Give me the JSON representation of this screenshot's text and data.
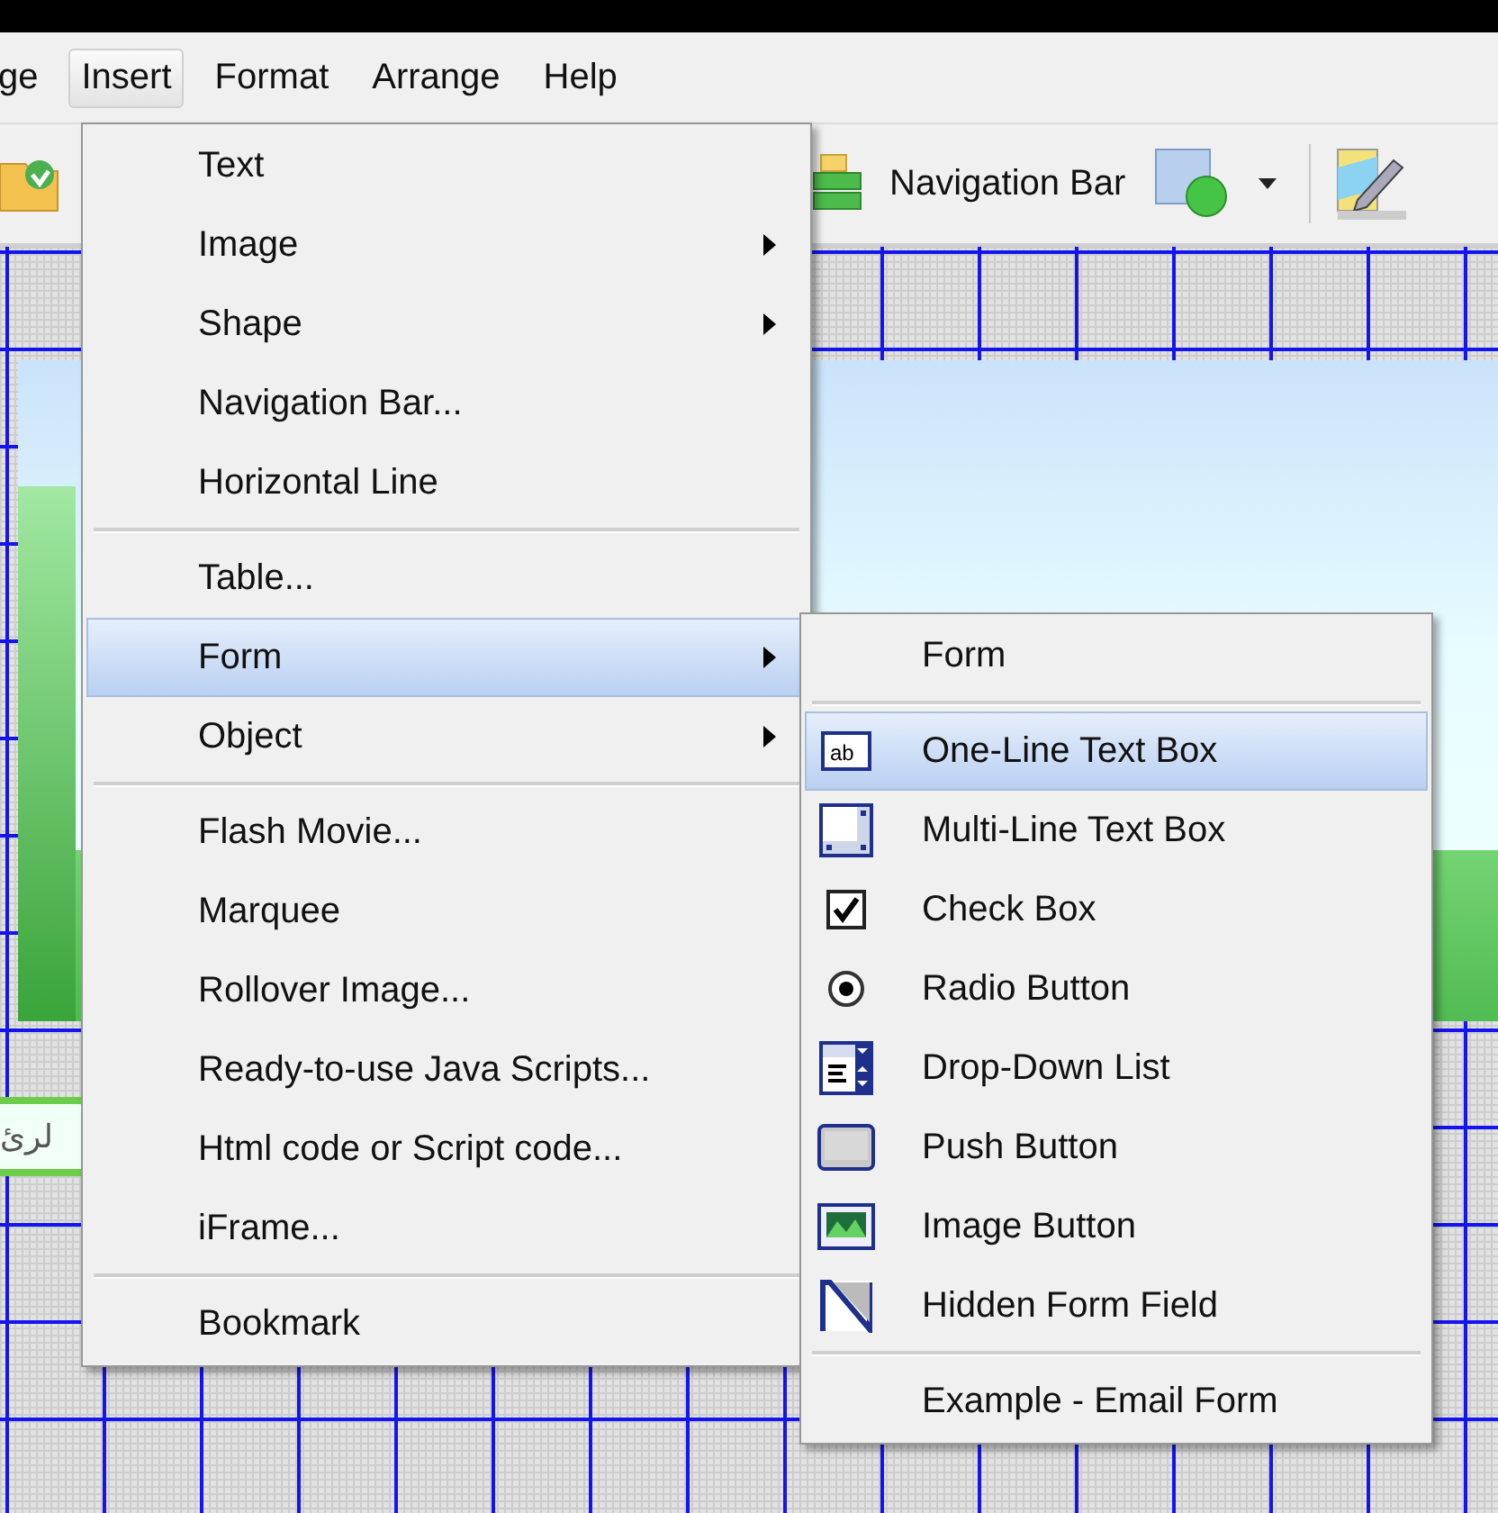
{
  "menu_bar": {
    "items": [
      {
        "label": "ge",
        "selected": false
      },
      {
        "label": "Insert",
        "selected": true
      },
      {
        "label": "Format",
        "selected": false
      },
      {
        "label": "Arrange",
        "selected": false
      },
      {
        "label": "Help",
        "selected": false
      }
    ]
  },
  "toolbar": {
    "navigation_button": {
      "label": "Navigation Bar"
    }
  },
  "canvas": {
    "text_field": {
      "value": "لرئ"
    }
  },
  "insert_menu": {
    "groups": [
      {
        "items": [
          {
            "label": "Text",
            "has_submenu": false,
            "selected": false
          },
          {
            "label": "Image",
            "has_submenu": true,
            "selected": false
          },
          {
            "label": "Shape",
            "has_submenu": true,
            "selected": false
          },
          {
            "label": "Navigation Bar...",
            "has_submenu": false,
            "selected": false
          },
          {
            "label": "Horizontal Line",
            "has_submenu": false,
            "selected": false
          }
        ]
      },
      {
        "items": [
          {
            "label": "Table...",
            "has_submenu": false,
            "selected": false
          },
          {
            "label": "Form",
            "has_submenu": true,
            "selected": true
          },
          {
            "label": "Object",
            "has_submenu": true,
            "selected": false
          }
        ]
      },
      {
        "items": [
          {
            "label": "Flash Movie...",
            "has_submenu": false,
            "selected": false
          },
          {
            "label": "Marquee",
            "has_submenu": false,
            "selected": false
          },
          {
            "label": "Rollover Image...",
            "has_submenu": false,
            "selected": false
          },
          {
            "label": "Ready-to-use Java Scripts...",
            "has_submenu": false,
            "selected": false
          },
          {
            "label": "Html code or Script code...",
            "has_submenu": false,
            "selected": false
          },
          {
            "label": "iFrame...",
            "has_submenu": false,
            "selected": false
          }
        ]
      },
      {
        "items": [
          {
            "label": "Bookmark",
            "has_submenu": false,
            "selected": false
          }
        ]
      }
    ]
  },
  "form_submenu": {
    "groups": [
      {
        "items": [
          {
            "kind": "plain",
            "label": "Form",
            "selected": false
          }
        ]
      },
      {
        "items": [
          {
            "kind": "textbox",
            "label": "One-Line Text Box",
            "icon_text": "ab",
            "selected": true
          },
          {
            "kind": "textarea",
            "label": "Multi-Line Text Box",
            "selected": false
          },
          {
            "kind": "checkbox",
            "label": "Check Box",
            "selected": false
          },
          {
            "kind": "radio",
            "label": "Radio Button",
            "selected": false
          },
          {
            "kind": "dropdown",
            "label": "Drop-Down List",
            "selected": false
          },
          {
            "kind": "pushbutton",
            "label": "Push Button",
            "selected": false
          },
          {
            "kind": "imagebutton",
            "label": "Image Button",
            "selected": false
          },
          {
            "kind": "hidden",
            "label": "Hidden Form Field",
            "selected": false
          }
        ]
      },
      {
        "items": [
          {
            "kind": "plain",
            "label": "Example - Email Form",
            "selected": false
          }
        ]
      }
    ]
  }
}
